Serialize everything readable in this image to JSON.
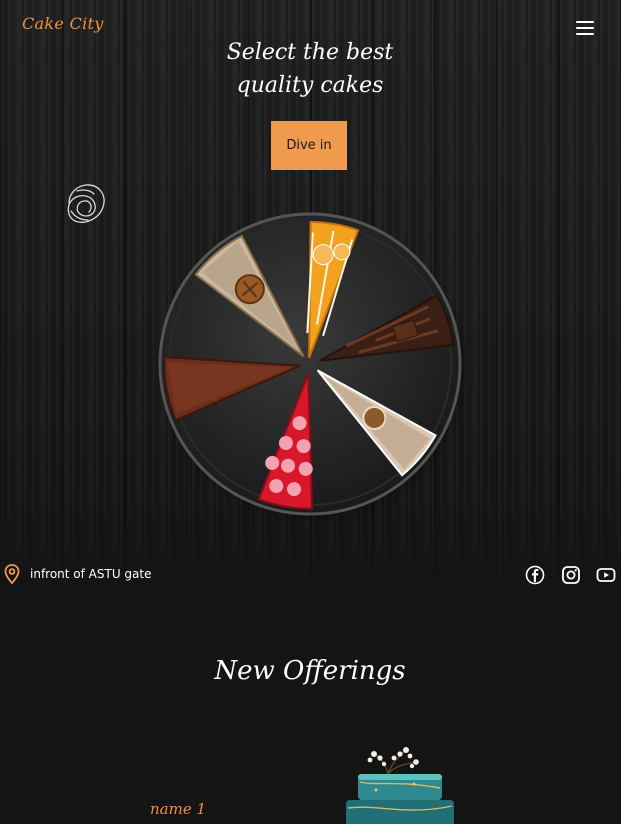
{
  "header": {
    "logo": "Cake City",
    "menu_icon": "hamburger-menu-icon"
  },
  "hero": {
    "headline_line1": "Select the best",
    "headline_line2": "quality cakes",
    "cta_label": "Dive in",
    "decor_icon": "pretzel-sketch-icon",
    "image": "assorted-cake-slices-plate"
  },
  "location": {
    "icon": "map-pin-icon",
    "text": "infront of ASTU gate"
  },
  "social": {
    "facebook": "facebook-icon",
    "instagram": "instagram-icon",
    "youtube": "youtube-icon"
  },
  "offerings": {
    "title": "New Offerings",
    "items": [
      {
        "name": "name 1",
        "image": "teal-tiered-cake"
      }
    ]
  },
  "colors": {
    "accent": "#ef9a4d",
    "background": "#141414",
    "text": "#ffffff"
  }
}
